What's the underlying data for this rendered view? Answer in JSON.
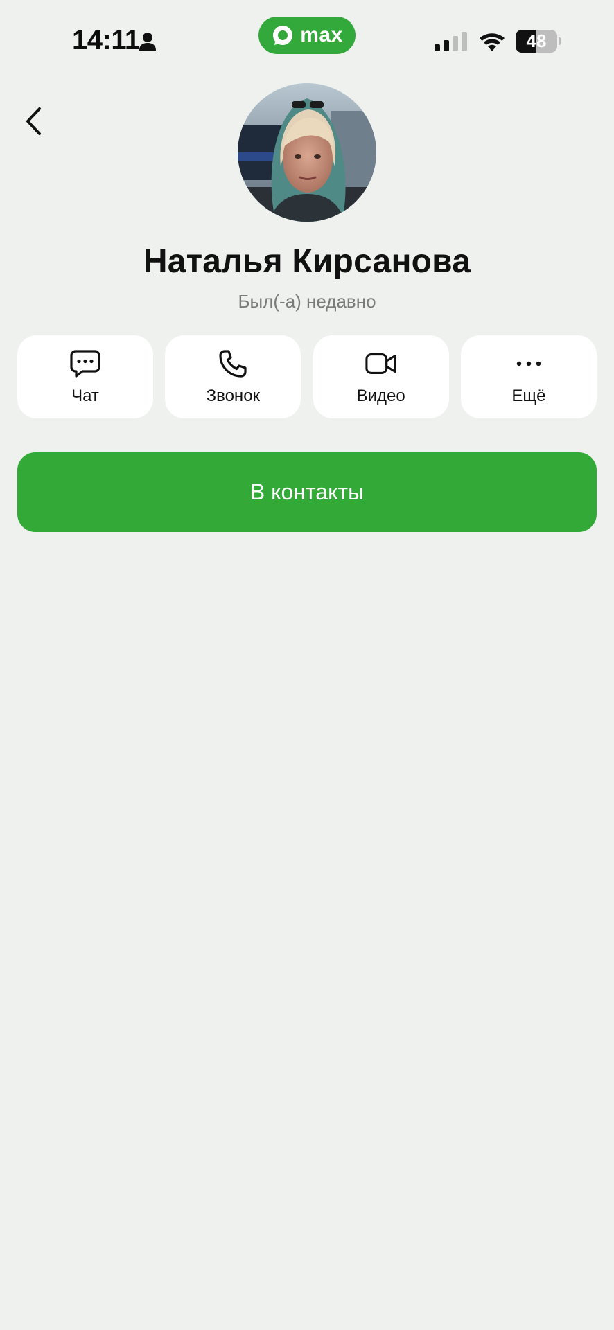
{
  "status_bar": {
    "time": "14:11",
    "person_icon": "person-icon",
    "app_pill_label": "max",
    "battery_level": "48",
    "icons": [
      "signal-icon",
      "wifi-icon",
      "battery-icon"
    ]
  },
  "header": {
    "back_icon": "chevron-left-icon"
  },
  "profile": {
    "name": "Наталья Кирсанова",
    "status": "Был(-а) недавно",
    "avatar": "avatar-photo"
  },
  "actions": [
    {
      "label": "Чат",
      "icon": "chat-bubble-icon"
    },
    {
      "label": "Звонок",
      "icon": "phone-icon"
    },
    {
      "label": "Видео",
      "icon": "video-camera-icon"
    },
    {
      "label": "Ещё",
      "icon": "more-dots-icon"
    }
  ],
  "add_contact": {
    "label": "В контакты"
  },
  "colors": {
    "background": "#eff1ef",
    "accent_green": "#33a938",
    "card": "#ffffff",
    "muted_text": "#7a7a7a"
  }
}
